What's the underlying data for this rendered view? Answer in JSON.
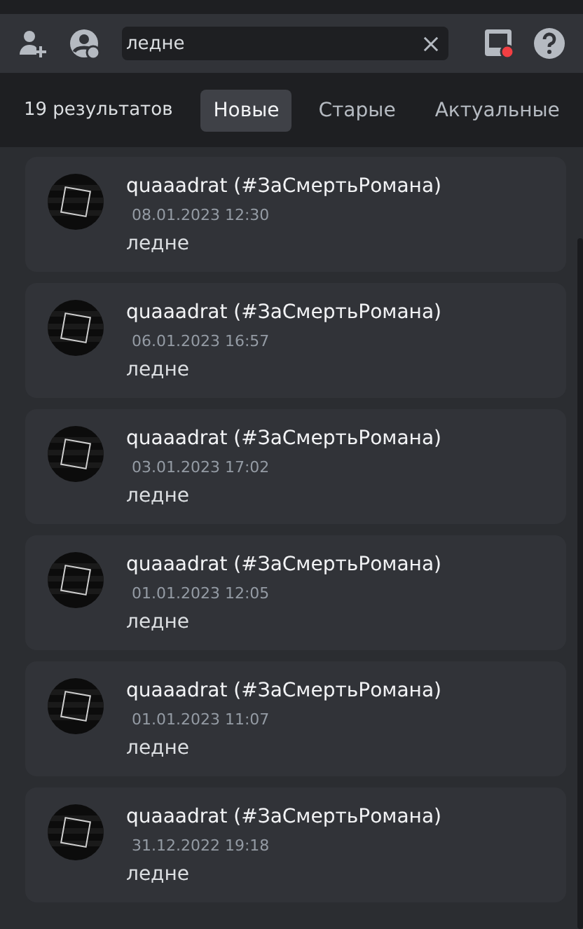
{
  "search": {
    "value": "ледне"
  },
  "results": {
    "count": "19 результатов",
    "sort_tabs": [
      {
        "label": "Новые",
        "selected": true
      },
      {
        "label": "Старые",
        "selected": false
      },
      {
        "label": "Актуальные",
        "selected": false
      }
    ]
  },
  "messages": [
    {
      "author": "quaaadrat (#ЗаСмертьРомана)",
      "timestamp": "08.01.2023 12:30",
      "text": "ледне"
    },
    {
      "author": "quaaadrat (#ЗаСмертьРомана)",
      "timestamp": "06.01.2023 16:57",
      "text": "ледне"
    },
    {
      "author": "quaaadrat (#ЗаСмертьРомана)",
      "timestamp": "03.01.2023 17:02",
      "text": "ледне"
    },
    {
      "author": "quaaadrat (#ЗаСмертьРомана)",
      "timestamp": "01.01.2023 12:05",
      "text": "ледне"
    },
    {
      "author": "quaaadrat (#ЗаСмертьРомана)",
      "timestamp": "01.01.2023 11:07",
      "text": "ледне"
    },
    {
      "author": "quaaadrat (#ЗаСмертьРомана)",
      "timestamp": "31.12.2022 19:18",
      "text": "ледне"
    }
  ]
}
